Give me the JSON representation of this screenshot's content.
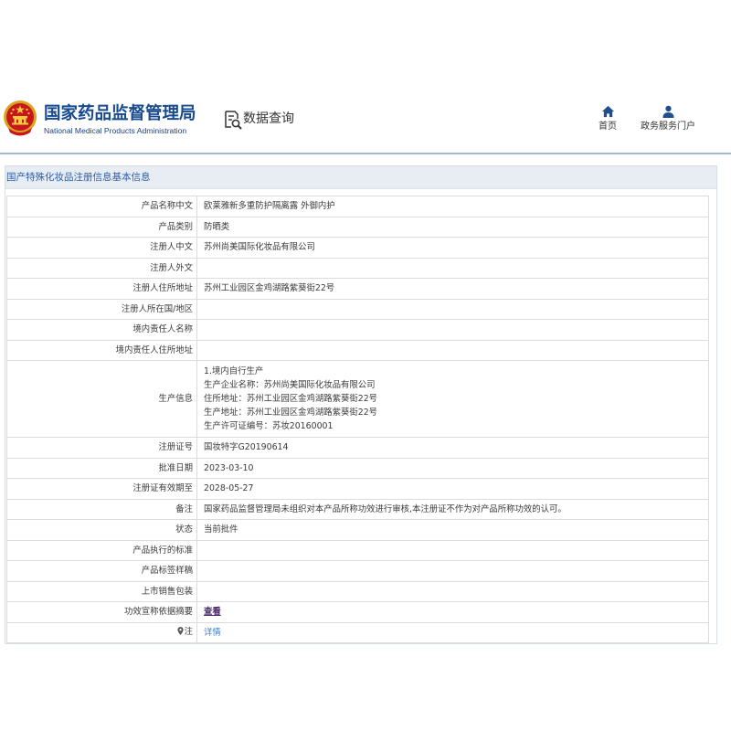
{
  "header": {
    "org_name_cn": "国家药品监督管理局",
    "org_name_en": "National Medical Products Administration",
    "data_query_label": "数据查询",
    "nav": [
      {
        "label": "首页",
        "icon": "home-icon"
      },
      {
        "label": "政务服务门户",
        "icon": "user-icon"
      }
    ]
  },
  "panel": {
    "title": "国产特殊化妆品注册信息基本信息",
    "rows": [
      {
        "label": "产品名称中文",
        "value": "欧莱雅新多重防护隔离露 外御内护"
      },
      {
        "label": "产品类别",
        "value": "防晒类"
      },
      {
        "label": "注册人中文",
        "value": "苏州尚美国际化妆品有限公司"
      },
      {
        "label": "注册人外文"
      },
      {
        "label": "注册人住所地址",
        "value": "苏州工业园区金鸡湖路紫葵街22号"
      },
      {
        "label": "注册人所在国/地区"
      },
      {
        "label": "境内责任人名称"
      },
      {
        "label": "境内责任人住所地址"
      },
      {
        "label": "生产信息",
        "lines": [
          "1.境内自行生产",
          "生产企业名称：苏州尚美国际化妆品有限公司",
          "住所地址：苏州工业园区金鸡湖路紫葵街22号",
          "生产地址：苏州工业园区金鸡湖路紫葵街22号",
          "生产许可证编号：苏妆20160001"
        ]
      },
      {
        "label": "注册证号",
        "value": "国妆特字G20190614"
      },
      {
        "label": "批准日期",
        "value": "2023-03-10"
      },
      {
        "label": "注册证有效期至",
        "value": "2028-05-27"
      },
      {
        "label": "备注",
        "value": "国家药品监督管理局未组织对本产品所称功效进行审核,本注册证不作为对产品所称功效的认可。"
      },
      {
        "label": "状态",
        "value": "当前批件"
      },
      {
        "label": "产品执行的标准"
      },
      {
        "label": "产品标签样稿"
      },
      {
        "label": "上市销售包装"
      },
      {
        "label": "功效宣称依据摘要",
        "value": "查看"
      },
      {
        "label": "注",
        "icon": "pin-icon",
        "value": "详情"
      }
    ]
  },
  "icons": {
    "emblem": "national-emblem-icon",
    "data_query": "data-query-icon",
    "home": "home-icon",
    "user": "user-icon"
  },
  "colors": {
    "brand_blue": "#174a8f",
    "panel_title": "#2b5ea6",
    "header_line": "#a3bbd9",
    "link_purple": "#4b2a6b",
    "link_blue": "#3a7bc8"
  }
}
